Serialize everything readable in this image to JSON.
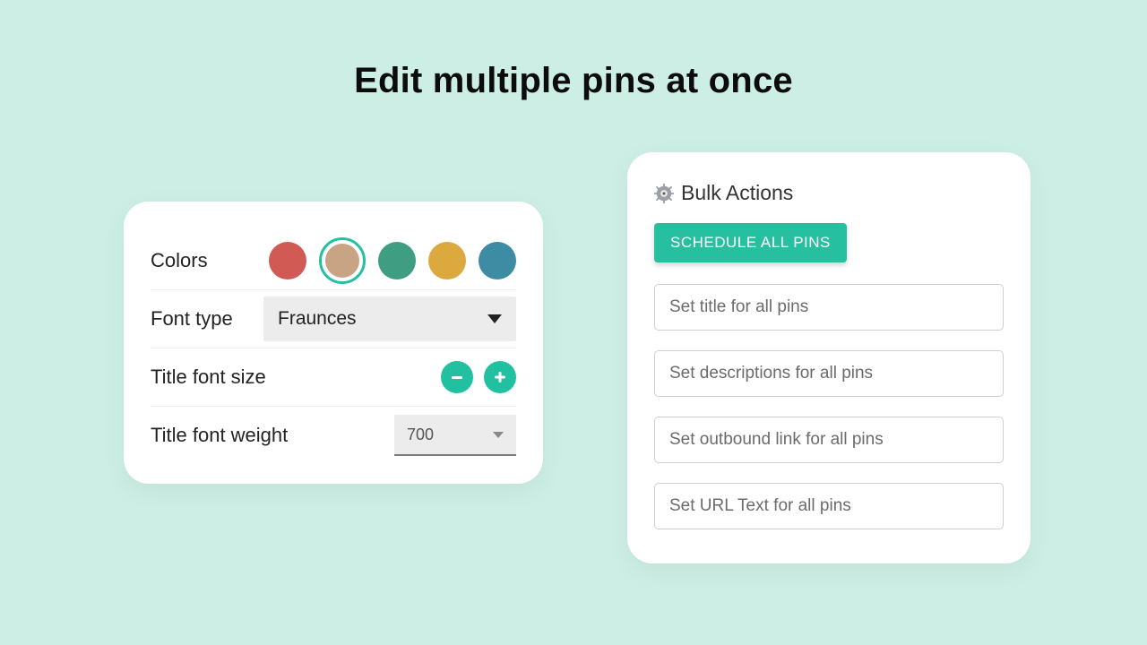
{
  "headline": "Edit multiple pins at once",
  "left_panel": {
    "colors_label": "Colors",
    "colors": {
      "items": [
        "#d25a55",
        "#c8a384",
        "#3f9e82",
        "#dba93e",
        "#3e8ca3"
      ],
      "selected_index": 1
    },
    "font_type_label": "Font type",
    "font_type_value": "Fraunces",
    "title_font_size_label": "Title font size",
    "title_font_weight_label": "Title font weight",
    "title_font_weight_value": "700"
  },
  "right_panel": {
    "header": "Bulk Actions",
    "schedule_button": "SCHEDULE ALL PINS",
    "fields": {
      "title": "Set title for all pins",
      "description": "Set descriptions for all pins",
      "outbound": "Set outbound link for all pins",
      "urltext": "Set URL Text for all pins"
    }
  }
}
